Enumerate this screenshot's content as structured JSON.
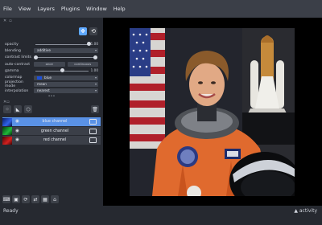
{
  "menu": [
    "File",
    "View",
    "Layers",
    "Plugins",
    "Window",
    "Help"
  ],
  "layer_controls": {
    "rows": [
      {
        "label": "opacity",
        "kind": "slider",
        "value": "1.00",
        "level": 1.0
      },
      {
        "label": "blending",
        "kind": "combo",
        "value": "additive"
      },
      {
        "label": "contrast limits",
        "kind": "range"
      },
      {
        "label": "auto-contrast",
        "kind": "segmented",
        "options": [
          "once",
          "continuous"
        ]
      },
      {
        "label": "gamma",
        "kind": "slider",
        "value": "1.00",
        "level": 0.5
      },
      {
        "label": "colormap",
        "kind": "combo",
        "value": "blue",
        "swatch": "#1d4fd6"
      },
      {
        "label": "projection mode",
        "kind": "combo",
        "value": "mean"
      },
      {
        "label": "interpolation",
        "kind": "combo",
        "value": "nearest"
      }
    ]
  },
  "layers": [
    {
      "name": "blue channel",
      "color": "#1d4fd6",
      "selected": true
    },
    {
      "name": "green channel",
      "color": "#16a32a",
      "selected": false
    },
    {
      "name": "red channel",
      "color": "#c9161b",
      "selected": false
    }
  ],
  "status": {
    "text": "Ready",
    "activity": "activity"
  },
  "colors": {
    "accent": "#5ea8ff",
    "selected_layer": "#5a92e6",
    "background": "#262930",
    "menubar": "#3b3f48"
  }
}
